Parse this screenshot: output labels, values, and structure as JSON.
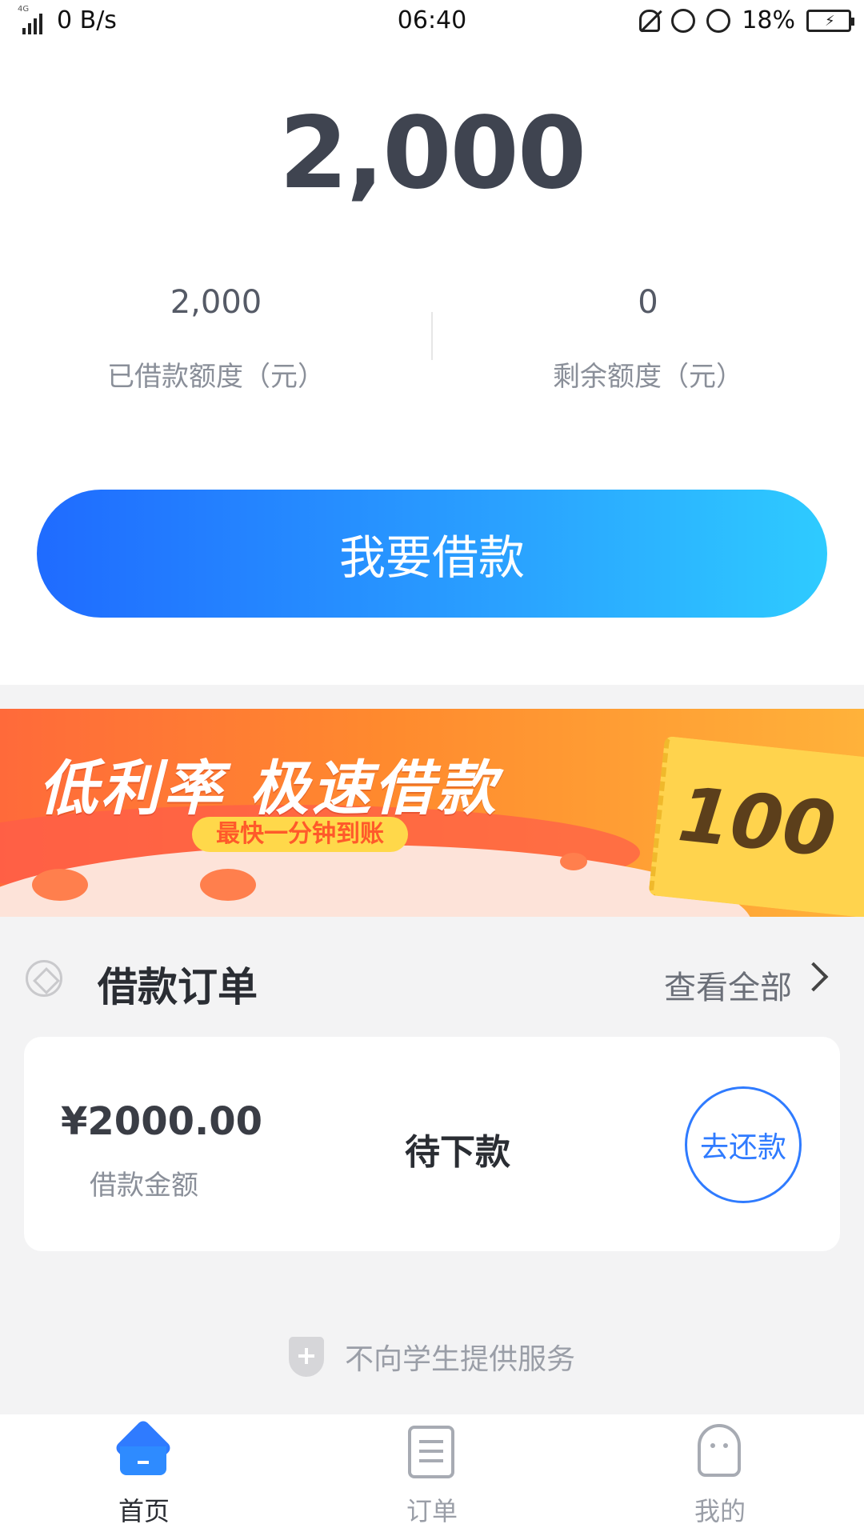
{
  "status_bar": {
    "network": "4G",
    "speed": "0 B/s",
    "time": "06:40",
    "battery": "18%"
  },
  "hero": {
    "total_amount": "2,000",
    "borrowed_value": "2,000",
    "borrowed_label": "已借款额度（元）",
    "remaining_value": "0",
    "remaining_label": "剩余额度（元）",
    "borrow_button": "我要借款"
  },
  "banner": {
    "title": "低利率 极速借款",
    "subtitle": "最快一分钟到账",
    "ticket_value": "100"
  },
  "orders": {
    "section_title": "借款订单",
    "view_all": "查看全部",
    "amount": "¥2000.00",
    "amount_label": "借款金额",
    "status": "待下款",
    "repay_button": "去还款"
  },
  "notice": {
    "text": "不向学生提供服务"
  },
  "tabbar": {
    "items": [
      {
        "label": "首页",
        "active": true
      },
      {
        "label": "订单",
        "active": false
      },
      {
        "label": "我的",
        "active": false
      }
    ]
  },
  "colors": {
    "accent": "#2f7bff",
    "button_gradient_start": "#1f6bff",
    "button_gradient_end": "#2ecbff"
  }
}
